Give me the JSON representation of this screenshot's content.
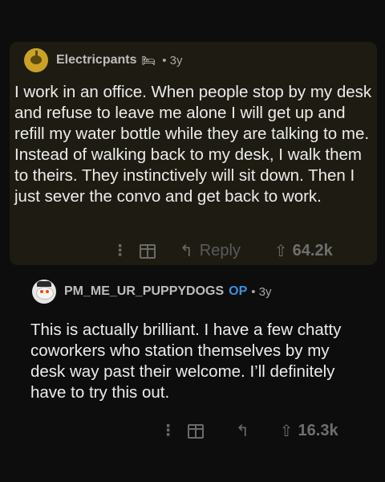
{
  "comment1": {
    "username": "Electricpants",
    "flair_icon": "bed-flair-icon",
    "time": "• 3y",
    "body": "I work in an office. When people stop by my desk and refuse to leave me alone I will get up and refill my water bottle while they are talking to me. Instead of walking back to my desk, I walk them to theirs. They instinctively will sit down. Then I just sever the convo and get back to work.",
    "actions": {
      "more": "⋮",
      "reply_label": "Reply",
      "upvotes": "64.2k"
    }
  },
  "comment2": {
    "username": "PM_ME_UR_PUPPYDOGS",
    "op_badge": "OP",
    "time": "• 3y",
    "body": "This is actually brilliant. I have a few chatty coworkers who station themselves by my desk way past their welcome. I’ll definitely have to try this out.",
    "actions": {
      "more": "⋮",
      "upvotes": "16.3k"
    }
  },
  "icons": {
    "reply": "↰",
    "upvote": "⇧"
  },
  "colors": {
    "op_badge": "#3b8fe0",
    "highlight_bg": "#1e1c12",
    "page_bg": "#0d0d0d"
  }
}
